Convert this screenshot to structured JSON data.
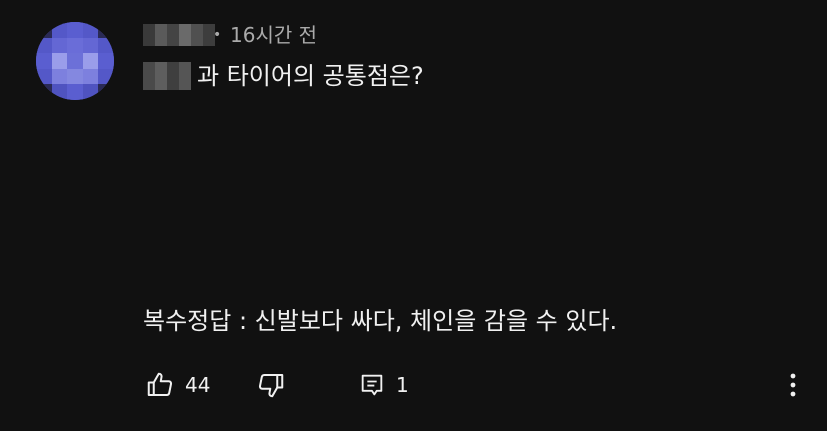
{
  "comment": {
    "timestamp": "16시간 전",
    "separator": "•",
    "first_line_text": "과 타이어의 공통점은?",
    "second_line_text": "복수정답 : 신발보다 싸다, 체인을 감을 수 있다."
  },
  "actions": {
    "like_count": "44",
    "reply_count": "1"
  },
  "icons": {
    "like": "thumbs-up-icon",
    "dislike": "thumbs-down-icon",
    "reply": "reply-icon",
    "more": "more-vertical-icon"
  },
  "colors": {
    "background": "#111111",
    "text": "#f1f1f1",
    "secondary_text": "#aaaaaa",
    "avatar": "#5a5ed0"
  }
}
